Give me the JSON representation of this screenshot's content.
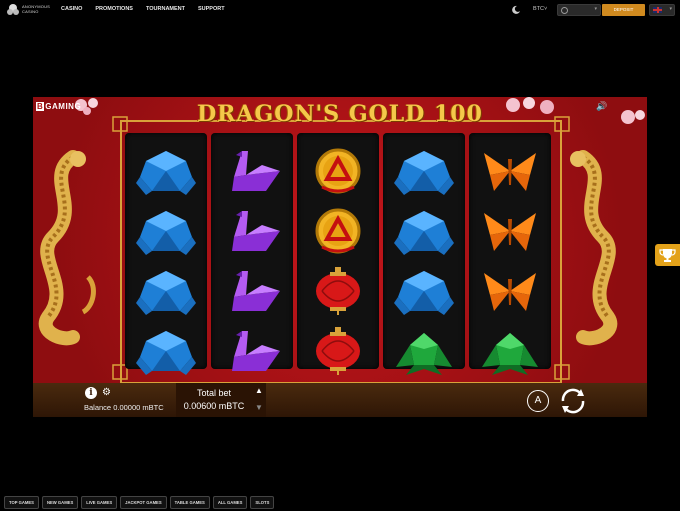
{
  "brand": {
    "logo_text": "ANONYMOUS CASINO"
  },
  "nav": {
    "items": [
      "CASINO",
      "PROMOTIONS",
      "TOURNAMENT",
      "SUPPORT"
    ]
  },
  "header": {
    "currency": "BTC",
    "deposit_label": "DEPOSIT"
  },
  "game": {
    "provider": "GAMING",
    "provider_badge": "B",
    "title": "DRAGON'S GOLD 100",
    "reels": [
      [
        "turtle",
        "turtle",
        "turtle",
        "turtle"
      ],
      [
        "swan",
        "swan",
        "swan",
        "swan"
      ],
      [
        "coin",
        "coin",
        "lantern",
        "lantern"
      ],
      [
        "turtle",
        "turtle",
        "turtle",
        "frog"
      ],
      [
        "butterfly",
        "butterfly",
        "butterfly",
        "frog"
      ]
    ]
  },
  "controls": {
    "balance_label": "Balance",
    "balance_value": "0.00000 mBTC",
    "total_bet_label": "Total bet",
    "total_bet_value": "0.00600 mBTC",
    "auto_label": "A"
  },
  "categories": [
    "TOP GAMES",
    "NEW GAMES",
    "LIVE GAMES",
    "JACKPOT GAMES",
    "TABLE GAMES",
    "ALL GAMES",
    "SLOTS"
  ],
  "colors": {
    "accent": "#d08a1f",
    "game_bg": "#b01414",
    "title_gold": "#f5c84a"
  }
}
